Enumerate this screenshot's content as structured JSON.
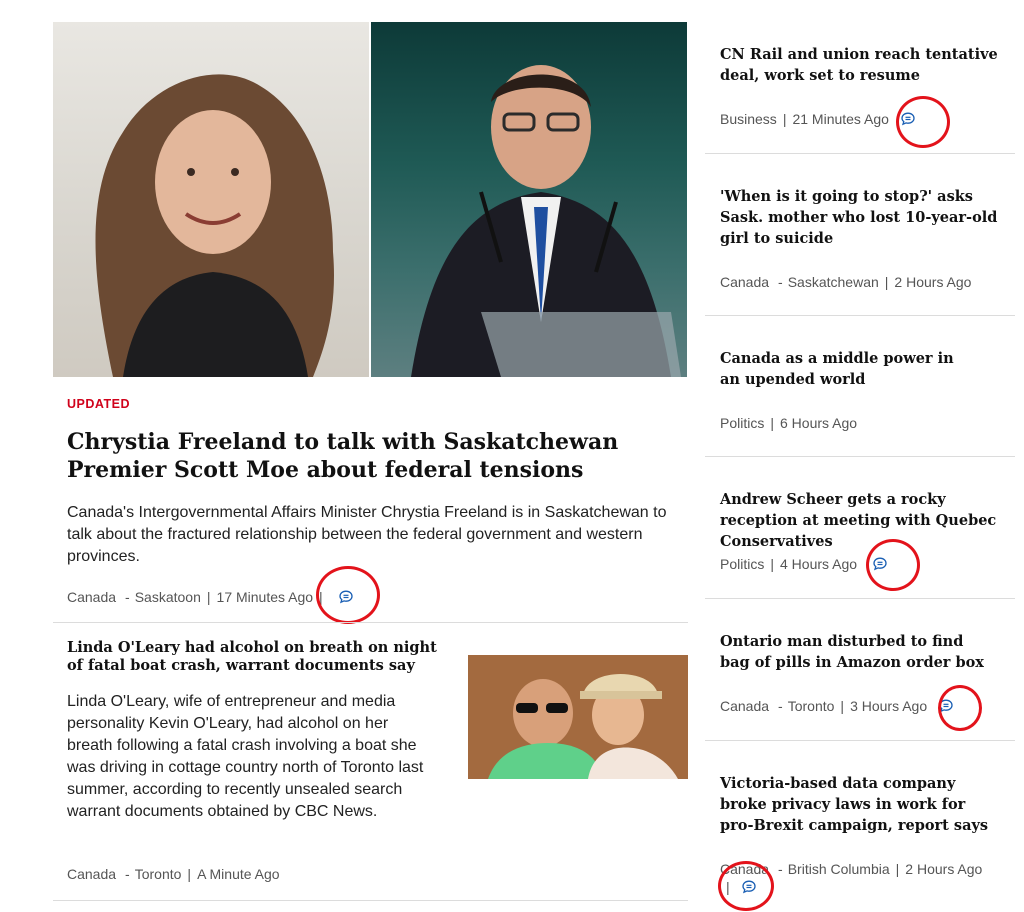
{
  "hero": {
    "badge": "UPDATED",
    "title": "Chrystia Freeland to talk with Saskatchewan Premier Scott Moe about federal tensions",
    "description": "Canada's Intergovernmental Affairs Minister Chrystia Freeland is in Saskatchewan to talk about the fractured relationship between the federal government and western provinces.",
    "category": "Canada",
    "location": "Saskatoon",
    "time": "17 Minutes Ago",
    "comment_icon": "comment-icon"
  },
  "story2": {
    "title": "Linda O'Leary had alcohol on breath on night of fatal boat crash, warrant documents say",
    "description": "Linda O'Leary, wife of entrepreneur and media personality Kevin O'Leary, had alcohol on her breath following a fatal crash involving a boat she was driving in cottage country north of Toronto last summer, according to recently unsealed search warrant documents obtained by CBC News.",
    "category": "Canada",
    "location": "Toronto",
    "time": "A Minute Ago"
  },
  "sidebar": [
    {
      "title": "CN Rail and union reach tentative deal, work set to resume",
      "category": "Business",
      "location": "",
      "time": "21 Minutes Ago"
    },
    {
      "title": "'When is it going to stop?' asks Sask. mother who lost 10-year-old girl to suicide",
      "category": "Canada",
      "location": "Saskatchewan",
      "time": "2 Hours Ago"
    },
    {
      "title": "Canada as a middle power in an upended world",
      "category": "Politics",
      "location": "",
      "time": "6 Hours Ago"
    },
    {
      "title": "Andrew Scheer gets a rocky reception at meeting with Quebec Conservatives",
      "category": "Politics",
      "location": "",
      "time": "4 Hours Ago"
    },
    {
      "title": "Ontario man disturbed to find bag of pills in Amazon order box",
      "category": "Canada",
      "location": "Toronto",
      "time": "3 Hours Ago"
    },
    {
      "title": "Victoria-based data company broke privacy laws in work for pro-Brexit campaign, report says",
      "category": "Canada",
      "location": "British Columbia",
      "time": "2 Hours Ago"
    }
  ],
  "colors": {
    "accent_red": "#d0021b",
    "highlight_ring": "#e3131b",
    "comment_blue": "#1a5fb4"
  },
  "separators": {
    "pipe": "|",
    "dash": "-"
  }
}
